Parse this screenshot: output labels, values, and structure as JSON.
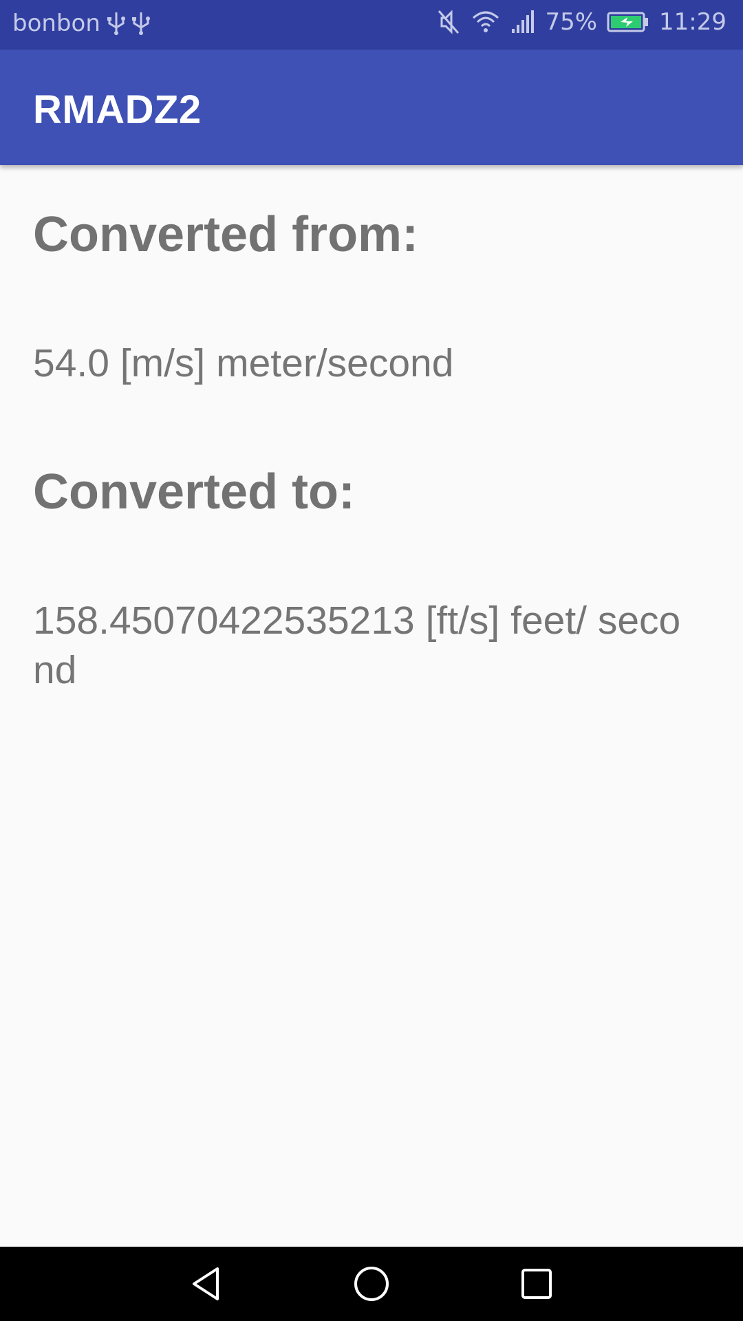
{
  "status_bar": {
    "carrier": "bonbon",
    "battery_percent": "75%",
    "time": "11:29",
    "icons": [
      "usb-icon",
      "usb-icon",
      "mute-icon",
      "wifi-icon",
      "signal-icon",
      "battery-charging-icon"
    ],
    "background_color": "#303f9f"
  },
  "app_bar": {
    "title": "RMADZ2",
    "background_color": "#3f51b5"
  },
  "conversion": {
    "from_heading": "Converted from:",
    "from_value": "54.0 [m/s] meter/second",
    "to_heading": "Converted to:",
    "to_value": "158.45070422535213 [ft/s] feet/ second"
  },
  "nav_bar": {
    "buttons": [
      "back-icon",
      "home-icon",
      "recents-icon"
    ]
  }
}
